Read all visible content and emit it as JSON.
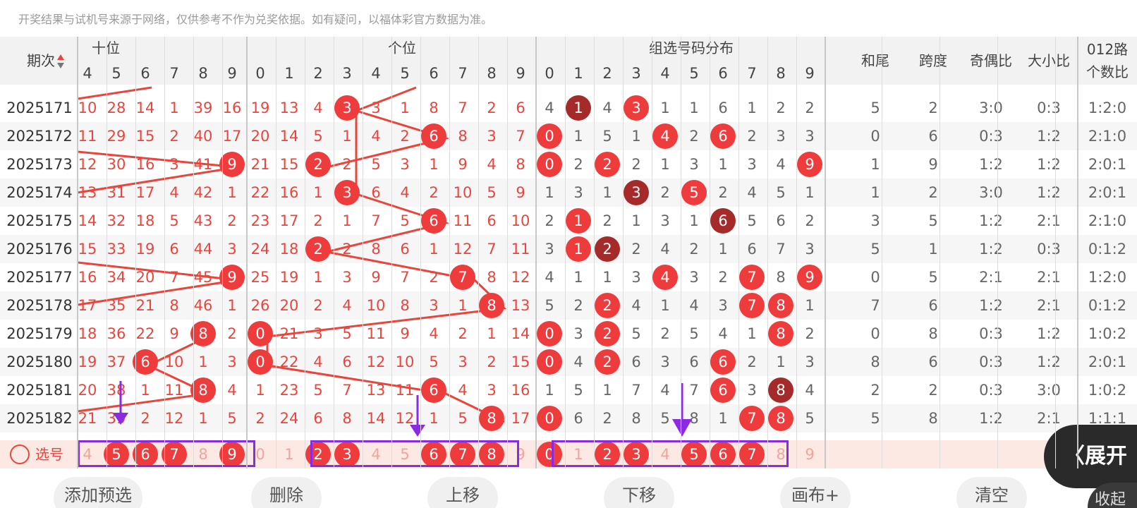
{
  "disclaimer": "开奖结果与试机号来源于网络，仅供参考不作为兑奖依据。如有疑问，以福体彩官方数据为准。",
  "headers": {
    "period": "期次",
    "tens": "十位",
    "units": "个位",
    "group": "组选号码分布",
    "sum_tail": "和尾",
    "span": "跨度",
    "odd_even": "奇偶比",
    "big_small": "大小比",
    "route_line1": "012路",
    "route_line2": "个数比"
  },
  "tens_digits": [
    "4",
    "5",
    "6",
    "7",
    "8",
    "9"
  ],
  "units_digits": [
    "0",
    "1",
    "2",
    "3",
    "4",
    "5",
    "6",
    "7",
    "8",
    "9"
  ],
  "group_digits": [
    "0",
    "1",
    "2",
    "3",
    "4",
    "5",
    "6",
    "7",
    "8",
    "9"
  ],
  "rows": [
    {
      "period": "2025171",
      "tens": [
        "10",
        "28",
        "14",
        "1",
        "39",
        "16"
      ],
      "units": [
        "19",
        "13",
        "4",
        "3",
        "3",
        "1",
        "8",
        "7",
        "2",
        "6"
      ],
      "group": [
        "4",
        "1",
        "4",
        "3",
        "1",
        "1",
        "6",
        "1",
        "2",
        "2"
      ],
      "sum_tail": "5",
      "span": "2",
      "odd_even": "3:0",
      "big_small": "0:3",
      "route": "1:2:0"
    },
    {
      "period": "2025172",
      "tens": [
        "11",
        "29",
        "15",
        "2",
        "40",
        "17"
      ],
      "units": [
        "20",
        "14",
        "5",
        "1",
        "4",
        "2",
        "6",
        "8",
        "3",
        "7"
      ],
      "group": [
        "0",
        "1",
        "5",
        "1",
        "4",
        "2",
        "6",
        "2",
        "3",
        "3"
      ],
      "sum_tail": "0",
      "span": "6",
      "odd_even": "0:3",
      "big_small": "1:2",
      "route": "2:1:0"
    },
    {
      "period": "2025173",
      "tens": [
        "12",
        "30",
        "16",
        "3",
        "41",
        "9"
      ],
      "units": [
        "21",
        "15",
        "2",
        "2",
        "5",
        "3",
        "1",
        "9",
        "4",
        "8"
      ],
      "group": [
        "0",
        "2",
        "2",
        "2",
        "1",
        "3",
        "1",
        "3",
        "4",
        "9"
      ],
      "sum_tail": "1",
      "span": "9",
      "odd_even": "1:2",
      "big_small": "1:2",
      "route": "2:0:1"
    },
    {
      "period": "2025174",
      "tens": [
        "13",
        "31",
        "17",
        "4",
        "42",
        "1"
      ],
      "units": [
        "22",
        "16",
        "1",
        "3",
        "6",
        "4",
        "2",
        "10",
        "5",
        "9"
      ],
      "group": [
        "1",
        "3",
        "1",
        "3",
        "2",
        "5",
        "2",
        "4",
        "5",
        "1"
      ],
      "sum_tail": "1",
      "span": "2",
      "odd_even": "3:0",
      "big_small": "1:2",
      "route": "2:0:1"
    },
    {
      "period": "2025175",
      "tens": [
        "14",
        "32",
        "18",
        "5",
        "43",
        "2"
      ],
      "units": [
        "23",
        "17",
        "2",
        "1",
        "7",
        "5",
        "6",
        "11",
        "6",
        "10"
      ],
      "group": [
        "2",
        "1",
        "2",
        "1",
        "3",
        "1",
        "6",
        "5",
        "6",
        "2"
      ],
      "sum_tail": "3",
      "span": "5",
      "odd_even": "1:2",
      "big_small": "2:1",
      "route": "2:1:0"
    },
    {
      "period": "2025176",
      "tens": [
        "15",
        "33",
        "19",
        "6",
        "44",
        "3"
      ],
      "units": [
        "24",
        "18",
        "2",
        "2",
        "8",
        "6",
        "1",
        "12",
        "7",
        "11"
      ],
      "group": [
        "3",
        "1",
        "2",
        "2",
        "4",
        "2",
        "1",
        "6",
        "7",
        "3"
      ],
      "sum_tail": "5",
      "span": "1",
      "odd_even": "1:2",
      "big_small": "0:3",
      "route": "0:1:2"
    },
    {
      "period": "2025177",
      "tens": [
        "16",
        "34",
        "20",
        "7",
        "45",
        "9"
      ],
      "units": [
        "25",
        "19",
        "1",
        "3",
        "9",
        "7",
        "2",
        "7",
        "8",
        "12"
      ],
      "group": [
        "4",
        "1",
        "1",
        "3",
        "4",
        "3",
        "2",
        "7",
        "8",
        "9"
      ],
      "sum_tail": "0",
      "span": "5",
      "odd_even": "2:1",
      "big_small": "2:1",
      "route": "1:2:0"
    },
    {
      "period": "2025178",
      "tens": [
        "17",
        "35",
        "21",
        "8",
        "46",
        "1"
      ],
      "units": [
        "26",
        "20",
        "2",
        "4",
        "10",
        "8",
        "3",
        "1",
        "8",
        "13"
      ],
      "group": [
        "5",
        "2",
        "2",
        "4",
        "1",
        "4",
        "3",
        "7",
        "8",
        "1"
      ],
      "sum_tail": "7",
      "span": "6",
      "odd_even": "1:2",
      "big_small": "2:1",
      "route": "0:1:2"
    },
    {
      "period": "2025179",
      "tens": [
        "18",
        "36",
        "22",
        "9",
        "8",
        "2"
      ],
      "units": [
        "0",
        "21",
        "3",
        "5",
        "11",
        "9",
        "4",
        "2",
        "1",
        "14"
      ],
      "group": [
        "0",
        "3",
        "2",
        "5",
        "2",
        "5",
        "4",
        "1",
        "8",
        "2"
      ],
      "sum_tail": "0",
      "span": "8",
      "odd_even": "0:3",
      "big_small": "1:2",
      "route": "1:0:2"
    },
    {
      "period": "2025180",
      "tens": [
        "19",
        "37",
        "6",
        "10",
        "1",
        "3"
      ],
      "units": [
        "0",
        "22",
        "4",
        "6",
        "12",
        "10",
        "5",
        "3",
        "2",
        "15"
      ],
      "group": [
        "0",
        "4",
        "2",
        "6",
        "3",
        "6",
        "6",
        "2",
        "1",
        "3"
      ],
      "sum_tail": "8",
      "span": "6",
      "odd_even": "0:3",
      "big_small": "1:2",
      "route": "2:0:1"
    },
    {
      "period": "2025181",
      "tens": [
        "20",
        "38",
        "1",
        "11",
        "8",
        "4"
      ],
      "units": [
        "1",
        "23",
        "5",
        "7",
        "13",
        "11",
        "6",
        "4",
        "3",
        "16"
      ],
      "group": [
        "1",
        "5",
        "1",
        "7",
        "4",
        "7",
        "6",
        "3",
        "8",
        "4"
      ],
      "sum_tail": "2",
      "span": "2",
      "odd_even": "0:3",
      "big_small": "3:0",
      "route": "1:0:2"
    },
    {
      "period": "2025182",
      "tens": [
        "21",
        "39",
        "2",
        "12",
        "1",
        "5"
      ],
      "units": [
        "2",
        "24",
        "6",
        "8",
        "14",
        "12",
        "1",
        "5",
        "8",
        "17"
      ],
      "group": [
        "0",
        "6",
        "2",
        "8",
        "5",
        "8",
        "1",
        "7",
        "8",
        "5"
      ],
      "sum_tail": "5",
      "span": "8",
      "odd_even": "1:2",
      "big_small": "2:1",
      "route": "1:1:1"
    }
  ],
  "select_row": {
    "label": "选号",
    "tens": [
      "4",
      "5",
      "6",
      "7",
      "8",
      "9"
    ],
    "units": [
      "0",
      "1",
      "2",
      "3",
      "4",
      "5",
      "6",
      "7",
      "8",
      "9"
    ],
    "group": [
      "0",
      "1",
      "2",
      "3",
      "4",
      "5",
      "6",
      "7",
      "8",
      "9"
    ]
  },
  "buttons": {
    "add": "添加预选",
    "delete": "删除",
    "up": "上移",
    "down": "下移",
    "canvas": "画布+",
    "clear": "清空"
  },
  "expand_label": "展开",
  "collapse_label": "收起",
  "colors": {
    "ball": "#ee3b3b",
    "ball_dark": "#a52a2a",
    "line": "#e8453c",
    "highlight_box": "#8a2be2"
  }
}
